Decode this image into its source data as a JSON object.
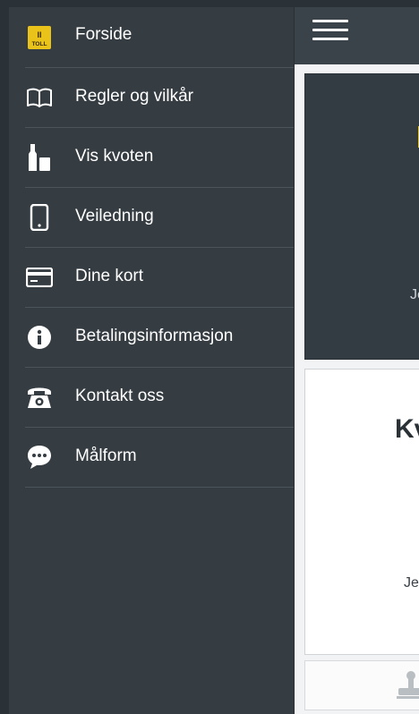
{
  "drawer": {
    "items": [
      {
        "label": "Forside",
        "icon": "toll-logo-icon"
      },
      {
        "label": "Regler og vilkår",
        "icon": "book-icon"
      },
      {
        "label": "Vis kvoten",
        "icon": "bottles-icon"
      },
      {
        "label": "Veiledning",
        "icon": "phone-icon"
      },
      {
        "label": "Dine kort",
        "icon": "credit-card-icon"
      },
      {
        "label": "Betalingsinformasjon",
        "icon": "info-icon"
      },
      {
        "label": "Kontakt oss",
        "icon": "telephone-icon"
      },
      {
        "label": "Målform",
        "icon": "chat-bubble-icon"
      }
    ]
  },
  "logo": {
    "text_top": "II",
    "text_bottom": "TOLL"
  },
  "main": {
    "card1_text": "Je",
    "card2_heading": "Kv",
    "card2_text": "Je"
  },
  "colors": {
    "drawer_bg": "#353d43",
    "accent_yellow": "#e9c31a",
    "divider": "#4b545b"
  }
}
